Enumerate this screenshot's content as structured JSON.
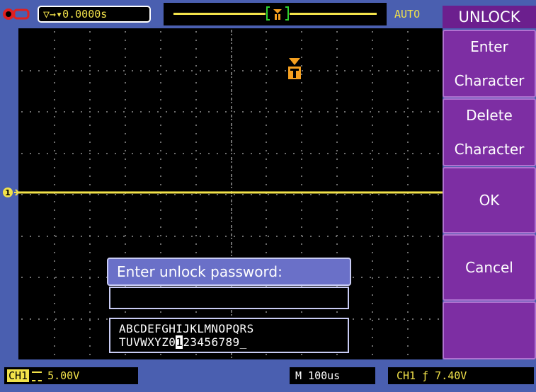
{
  "header": {
    "trigger_delay": "▽→▾0.0000s",
    "trigger_mode": "AUTO"
  },
  "menu": {
    "title": "UNLOCK",
    "items": [
      {
        "line1": "Enter",
        "line2": "Character"
      },
      {
        "line1": "Delete",
        "line2": "Character"
      },
      {
        "line1": "OK",
        "line2": ""
      },
      {
        "line1": "Cancel",
        "line2": ""
      },
      {
        "line1": "",
        "line2": ""
      }
    ]
  },
  "dialog": {
    "prompt": "Enter unlock password:",
    "password_value": "",
    "keyboard_row1": "ABCDEFGHIJKLMNOPQRS",
    "keyboard_row2_before": "TUVWXYZ0",
    "keyboard_selected": "1",
    "keyboard_row2_after": "23456789_"
  },
  "footer": {
    "ch1_tag": "CH1",
    "ch1_scale": "5.00V",
    "timebase": "M 100us",
    "trigger_info": "CH1 ƒ 7.40V"
  },
  "colors": {
    "trace": "#f2e24a",
    "trigger_marker": "#f5a020",
    "menu_purple": "#7d2ea3",
    "frame_blue": "#4a5fb0"
  }
}
